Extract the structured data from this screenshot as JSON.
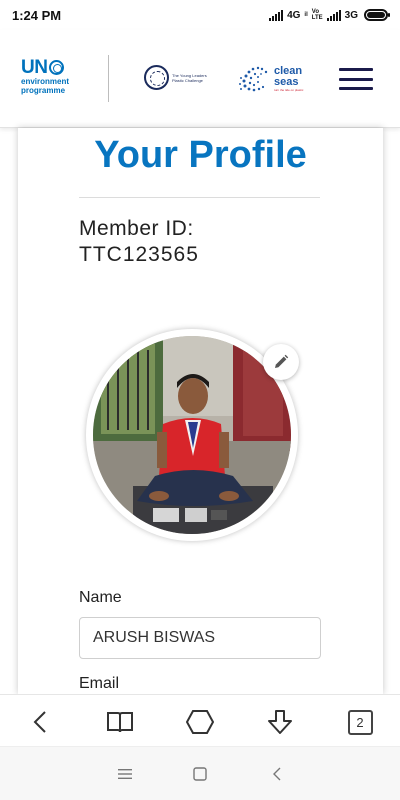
{
  "status_bar": {
    "time": "1:24 PM",
    "network_1": "4G",
    "network_1_sub": "il",
    "volte_top": "Vo",
    "volte_bottom": "LTE",
    "network_2": "3G"
  },
  "header": {
    "unep_title": "UN",
    "unep_subtitle_line1": "environment",
    "unep_subtitle_line2": "programme",
    "tlpc_text": "The Young Leaders Plastic Challenge",
    "cleanseas_line1": "clean",
    "cleanseas_line2": "seas",
    "cleanseas_tagline": "turn the tide on plastic"
  },
  "profile": {
    "title": "Your Profile",
    "member_id_label": "Member ID:",
    "member_id": "TTC123565",
    "name_label": "Name",
    "name_value": "ARUSH BISWAS",
    "email_label": "Email"
  },
  "browser_bar": {
    "tab_count": "2"
  },
  "colors": {
    "brand_blue": "#0875c0",
    "nav_dark": "#1b1b4b"
  },
  "icons": {
    "edit": "pencil-icon",
    "back": "chevron-left-icon",
    "bookmarks": "book-icon",
    "home": "home-icon",
    "download": "download-icon",
    "menu": "menu-icon"
  }
}
